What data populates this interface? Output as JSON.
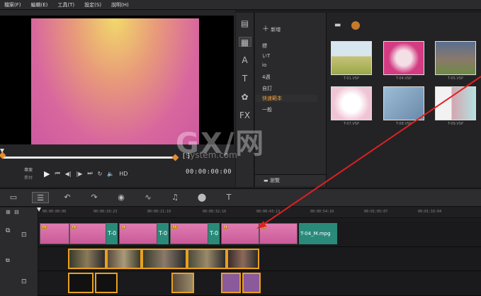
{
  "menu": {
    "items": [
      "檔案(F)",
      "編輯(E)",
      "工具(T)",
      "設定(S)",
      "說明(H)"
    ]
  },
  "player": {
    "mode_project": "專案",
    "mode_clip": "素材",
    "timecode": "00:00:00:00",
    "brackets": "[    ]",
    "hd_label": "HD"
  },
  "library": {
    "new_label": "新增",
    "categories": [
      "標",
      "いT",
      "io",
      "4週",
      "自訂",
      "快速範本",
      "一般"
    ],
    "selected_category": "快速範本",
    "browse_label": "瀏覽",
    "thumbnails": [
      {
        "label": "T-01.VSP",
        "bg": "#b9d07a"
      },
      {
        "label": "T-04.VSP",
        "bg": "#d33b82"
      },
      {
        "label": "T-05.VSP",
        "bg": "#6a8aa0"
      },
      {
        "label": "T-07.VSP",
        "bg": "#f6e6ee"
      },
      {
        "label": "T-08.VSP",
        "bg": "#8ab0cc"
      },
      {
        "label": "T-09.VSP",
        "bg": "#e2ecf2"
      }
    ]
  },
  "timeline": {
    "ruler": [
      "00:00:00:00",
      "00:00:10:23",
      "00:00:21:19",
      "00:00:32:16",
      "00:00:43:13",
      "00:00:54:10",
      "00:01:05:07",
      "00:01:16:04"
    ],
    "transition_label": "T-0",
    "clip_label": "T-04_M.mpg"
  },
  "watermark": {
    "big": "GX/网",
    "small": "system.com"
  },
  "colors": {
    "accent": "#e8a020",
    "preview_top": "#f1d96a",
    "preview_bottom": "#cc5aa0",
    "arrow": "#e02020"
  }
}
